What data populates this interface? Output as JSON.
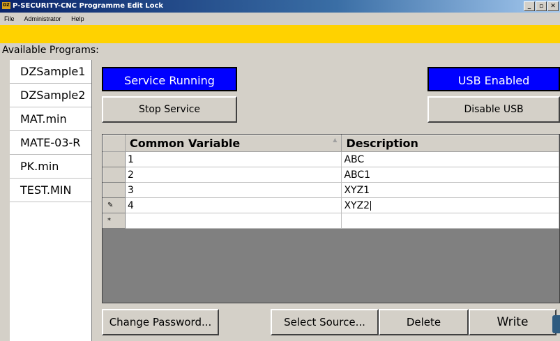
{
  "window": {
    "title": "P-SECURITY-CNC Programme Edit Lock",
    "icon": "app-icon",
    "icon_text": "DZ",
    "controls": {
      "minimize": "_",
      "maximize": "̘",
      "close": ""
    }
  },
  "menu": [
    "File",
    "Administrator",
    "Help"
  ],
  "programs": {
    "label": "Available Programs:",
    "items": [
      "DZSample1",
      "DZSample2",
      "MAT.min",
      "MATE-03-R",
      "PK.min",
      "TEST.MIN"
    ]
  },
  "status": {
    "service": "Service Running",
    "usb": "USB Enabled",
    "color": "#0000ff"
  },
  "buttons": {
    "stop_service": "Stop Service",
    "disable_usb": "Disable USB",
    "change_password": "Change Password...",
    "select_source": "Select Source...",
    "delete": "Delete",
    "write": "Write"
  },
  "grid": {
    "columns": [
      "Common Variable",
      "Description"
    ],
    "rows": [
      {
        "marker": "",
        "var": "1",
        "desc": "ABC"
      },
      {
        "marker": "",
        "var": "2",
        "desc": "ABC1"
      },
      {
        "marker": "",
        "var": "3",
        "desc": "XYZ1"
      },
      {
        "marker": "✎",
        "var": "4",
        "desc": "XYZ2"
      },
      {
        "marker": "*",
        "var": "",
        "desc": ""
      }
    ]
  }
}
